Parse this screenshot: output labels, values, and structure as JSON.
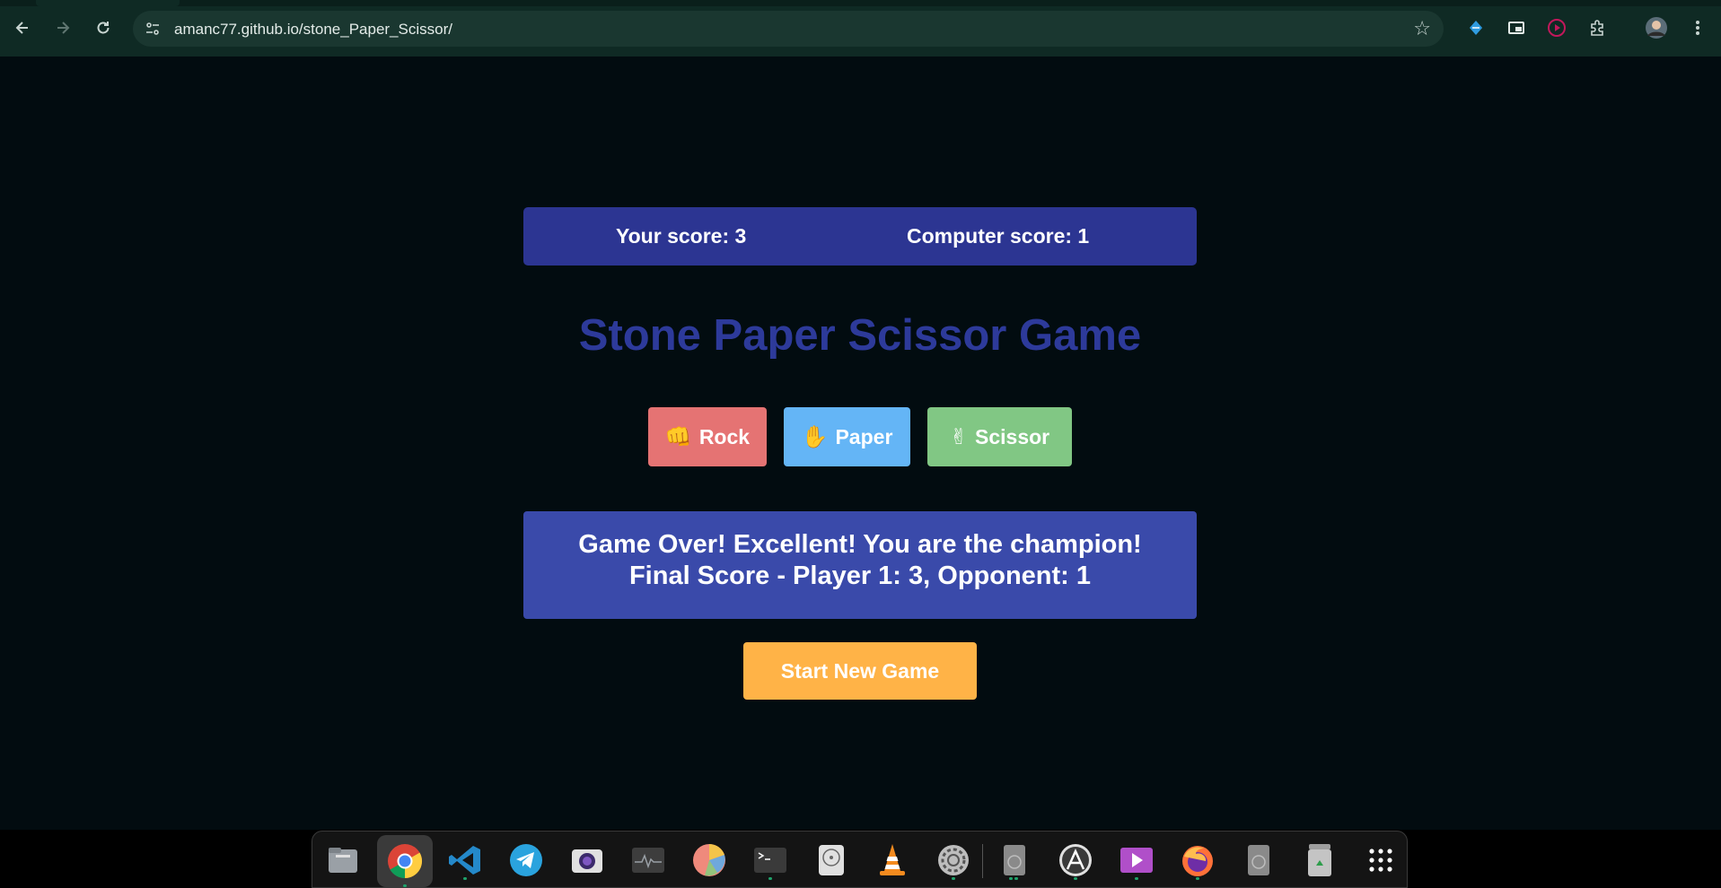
{
  "browser": {
    "url": "amanc77.github.io/stone_Paper_Scissor/"
  },
  "game": {
    "your_score": "Your score: 3",
    "computer_score": "Computer score: 1",
    "title": "Stone Paper Scissor Game",
    "choices": [
      {
        "emoji": "👊",
        "label": "Rock",
        "color": "#e57373"
      },
      {
        "emoji": "✋",
        "label": "Paper",
        "color": "#64b5f6"
      },
      {
        "emoji": "✌",
        "label": "Scissor",
        "color": "#81c784"
      }
    ],
    "result_line1": "Game Over! Excellent! You are the champion!",
    "result_line2": "Final Score - Player 1: 3, Opponent: 1",
    "new_game_label": "Start New Game"
  },
  "colors": {
    "score_bar": "#2c3592",
    "title": "#2d3a9a",
    "result_box": "#3a4aaa",
    "new_game_button": "#ffb347",
    "page_background": "#020c10"
  },
  "dock": {
    "items": [
      "files-icon",
      "chrome-icon",
      "vscode-icon",
      "telegram-icon",
      "camera-icon",
      "system-monitor-icon",
      "disk-usage-icon",
      "terminal-icon",
      "disk-utility-icon",
      "vlc-icon",
      "settings-icon",
      "disk-drive-icon",
      "software-updater-icon",
      "media-player-icon",
      "firefox-icon",
      "disk-drive-2-icon",
      "trash-icon",
      "app-grid-icon"
    ]
  }
}
